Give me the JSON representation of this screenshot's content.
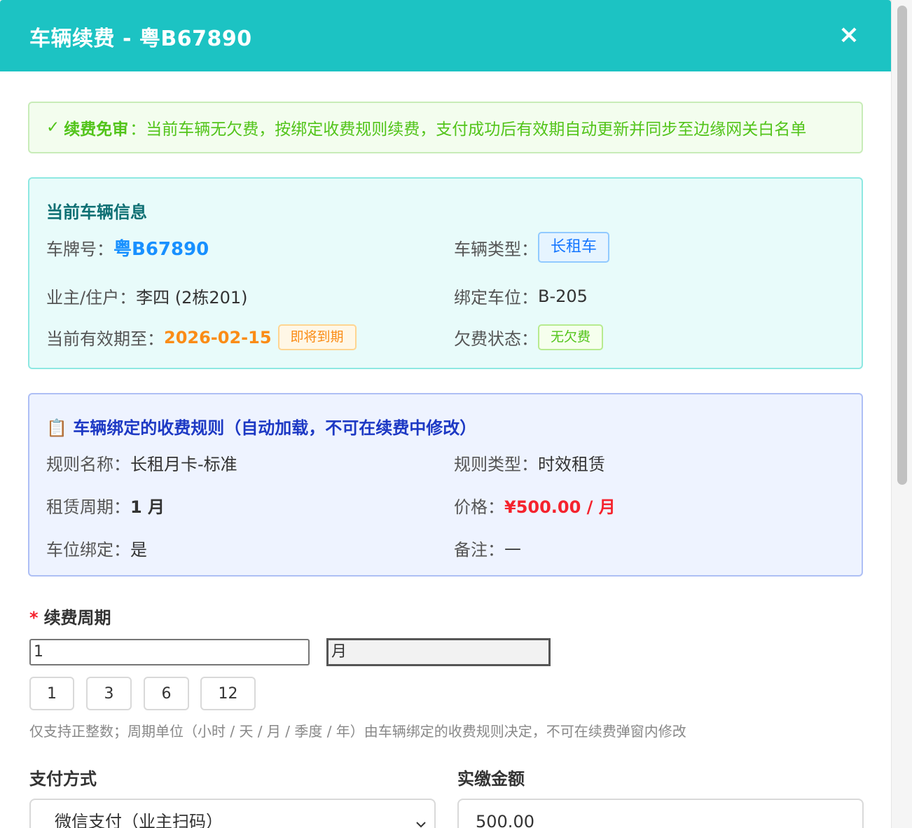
{
  "modal": {
    "title": "车辆续费 - 粤B67890",
    "close_label": "×"
  },
  "notice": {
    "icon": "✓",
    "title": "续费免审",
    "text": "：当前车辆无欠费，按绑定收费规则续费，支付成功后有效期自动更新并同步至边缘网关白名单"
  },
  "vehicle_info": {
    "title": "当前车辆信息",
    "plate_label": "车牌号：",
    "plate_value": "粤B67890",
    "type_label": "车辆类型：",
    "type_value": "长租车",
    "owner_label": "业主/住户：",
    "owner_value": "李四 (2栋201)",
    "space_label": "绑定车位：",
    "space_value": "B-205",
    "expire_label": "当前有效期至：",
    "expire_value": "2026-02-15",
    "expire_tag": "即将到期",
    "arrears_label": "欠费状态：",
    "arrears_value": "无欠费"
  },
  "rule_info": {
    "icon": "📋",
    "title": "车辆绑定的收费规则（自动加载，不可在续费中修改）",
    "name_label": "规则名称：",
    "name_value": "长租月卡-标准",
    "type_label": "规则类型：",
    "type_value": "时效租赁",
    "period_label": "租赁周期：",
    "period_value": "1 月",
    "price_label": "价格：",
    "price_value": "¥500.00 / 月",
    "bind_label": "车位绑定：",
    "bind_value": "是",
    "remark_label": "备注：",
    "remark_value": "—"
  },
  "renew": {
    "required_mark": "*",
    "label": "续费周期",
    "value": "1",
    "unit": "月",
    "quick_options": [
      "1",
      "3",
      "6",
      "12"
    ],
    "hint": "仅支持正整数；周期单位（小时 / 天 / 月 / 季度 / 年）由车辆绑定的收费规则决定，不可在续费弹窗内修改"
  },
  "payment": {
    "label": "支付方式",
    "selected": "微信支付（业主扫码）",
    "amount_label": "实缴金额",
    "amount_value": "500.00"
  },
  "colors": {
    "header": "#1cc3c3",
    "success": "#52c41a",
    "primary": "#1890ff",
    "warning": "#fa8c16",
    "danger": "#f5222d"
  }
}
